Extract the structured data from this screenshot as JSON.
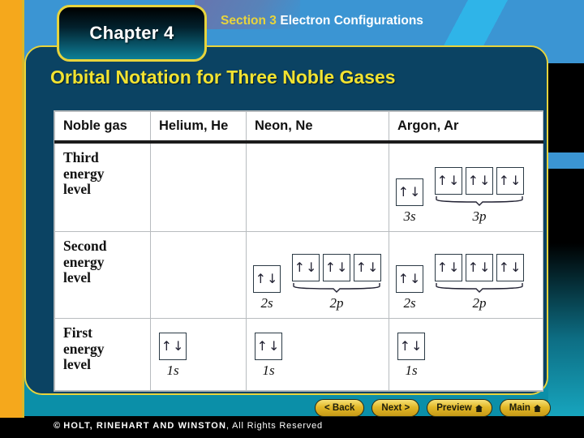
{
  "header": {
    "chapter_tab": "Chapter 4",
    "section_number": "Section 3",
    "section_title": "Electron Configurations"
  },
  "slide": {
    "title": "Orbital Notation for Three Noble Gases"
  },
  "table": {
    "columns": [
      "Noble gas",
      "Helium, He",
      "Neon, Ne",
      "Argon, Ar"
    ],
    "rows": [
      {
        "label": "Third\nenergy\nlevel",
        "helium": {
          "subshells": []
        },
        "neon": {
          "subshells": []
        },
        "argon": {
          "subshells": [
            {
              "name": "3s",
              "boxes": [
                "↑↓"
              ],
              "braced": false
            },
            {
              "name": "3p",
              "boxes": [
                "↑↓",
                "↑↓",
                "↑↓"
              ],
              "braced": true
            }
          ]
        }
      },
      {
        "label": "Second\nenergy\nlevel",
        "helium": {
          "subshells": []
        },
        "neon": {
          "subshells": [
            {
              "name": "2s",
              "boxes": [
                "↑↓"
              ],
              "braced": false
            },
            {
              "name": "2p",
              "boxes": [
                "↑↓",
                "↑↓",
                "↑↓"
              ],
              "braced": true
            }
          ]
        },
        "argon": {
          "subshells": [
            {
              "name": "2s",
              "boxes": [
                "↑↓"
              ],
              "braced": false
            },
            {
              "name": "2p",
              "boxes": [
                "↑↓",
                "↑↓",
                "↑↓"
              ],
              "braced": true
            }
          ]
        }
      },
      {
        "label": "First\nenergy\nlevel",
        "helium": {
          "subshells": [
            {
              "name": "1s",
              "boxes": [
                "↑↓"
              ],
              "braced": false
            }
          ]
        },
        "neon": {
          "subshells": [
            {
              "name": "1s",
              "boxes": [
                "↑↓"
              ],
              "braced": false
            }
          ]
        },
        "argon": {
          "subshells": [
            {
              "name": "1s",
              "boxes": [
                "↑↓"
              ],
              "braced": false
            }
          ]
        }
      }
    ]
  },
  "nav": {
    "back": "< Back",
    "next": "Next >",
    "preview": "Preview",
    "main": "Main",
    "home_icon": "home-icon"
  },
  "footer": {
    "copyright_symbol": "©",
    "publisher": "HOLT, RINEHART AND WINSTON",
    "rights": ", All Rights Reserved"
  },
  "colors": {
    "accent_yellow": "#e8d43c",
    "panel_blue": "#0b4363",
    "header_blue": "#3b95d3",
    "orange_bar": "#f5a81c",
    "title_yellow": "#f2e331"
  }
}
